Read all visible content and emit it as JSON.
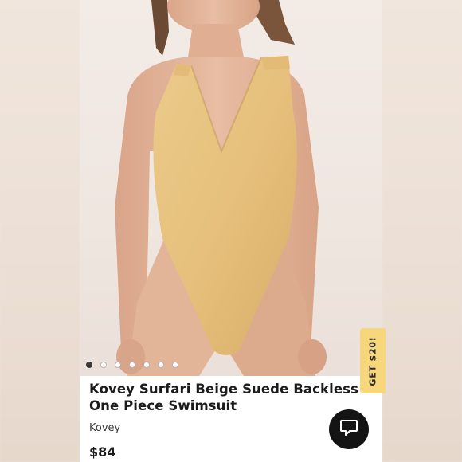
{
  "product": {
    "title": "Kovey Surfari Beige Suede Backless One Piece Swimsuit",
    "brand": "Kovey",
    "price": "$84"
  },
  "carousel": {
    "total_images": 7,
    "active_index": 0
  },
  "promo": {
    "label": "GET $20!"
  },
  "icons": {
    "chat": "chat-bubble-icon"
  },
  "colors": {
    "promo_tab": "#f6d77c",
    "chat_button": "#141414",
    "swimsuit": "#e7c27e"
  }
}
